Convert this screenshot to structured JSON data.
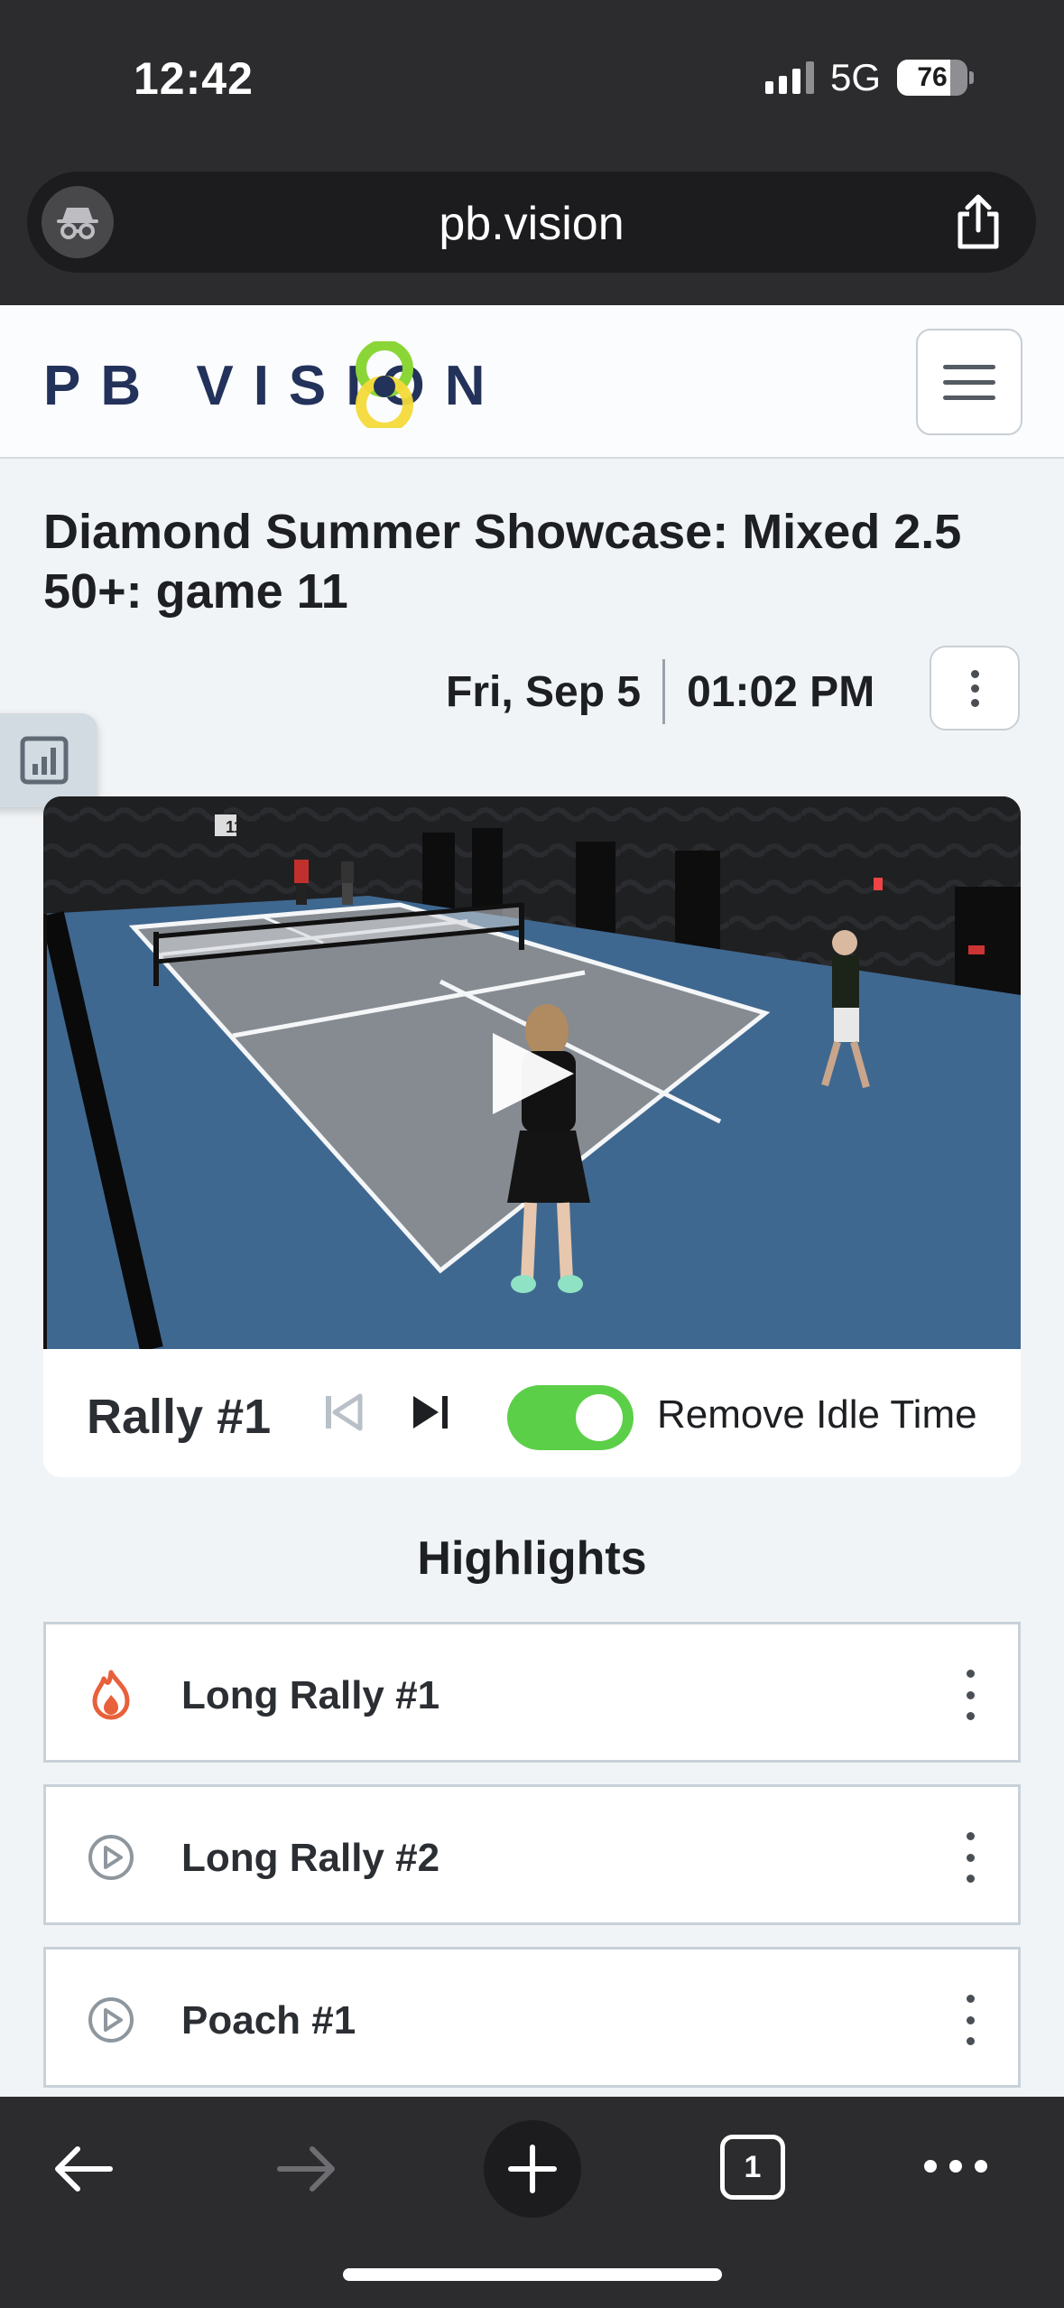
{
  "status_bar": {
    "time": "12:42",
    "network": "5G",
    "battery": "76",
    "battery_level": 0.76
  },
  "browser": {
    "url": "pb.vision",
    "tab_count": "1"
  },
  "header": {
    "logo_text": "PB VISION",
    "logo_colors": {
      "navy": "#23325a",
      "green": "#8ad637",
      "yellow": "#f4da3a"
    }
  },
  "game": {
    "title": "Diamond Summer Showcase: Mixed 2.5 50+: game 11",
    "date": "Fri, Sep 5",
    "time": "01:02 PM",
    "court_number": "11"
  },
  "player_controls": {
    "rally_label": "Rally #1",
    "remove_idle_label": "Remove Idle Time",
    "remove_idle_on": true,
    "toggle_color": "#5ccf48"
  },
  "highlights": {
    "heading": "Highlights",
    "items": [
      {
        "label": "Long Rally #1",
        "icon": "flame-icon"
      },
      {
        "label": "Long Rally #2",
        "icon": "play-circle-icon"
      },
      {
        "label": "Poach #1",
        "icon": "play-circle-icon"
      }
    ]
  }
}
